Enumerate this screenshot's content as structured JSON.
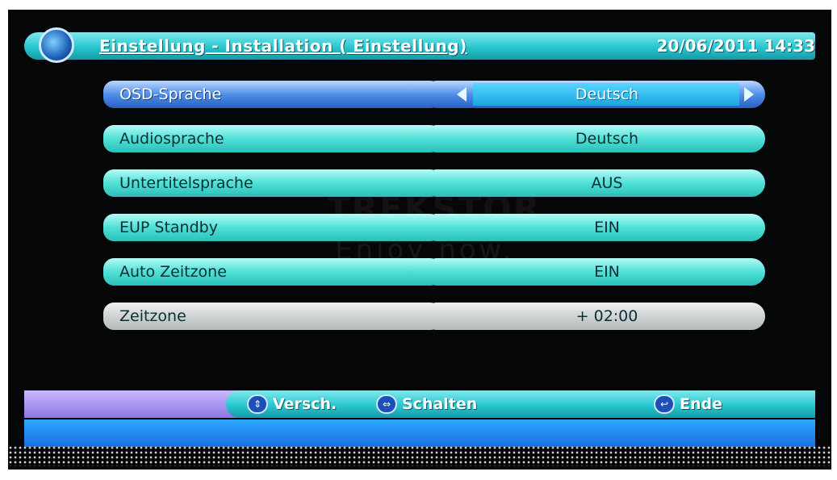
{
  "header": {
    "title": "Einstellung -  Installation ( Einstellung)",
    "datetime": "20/06/2011  14:33"
  },
  "watermark": {
    "brand": "TREKSTOR",
    "slogan": "Enjoy now."
  },
  "settings": [
    {
      "label": "OSD-Sprache",
      "value": "Deutsch",
      "selected": true
    },
    {
      "label": "Audiosprache",
      "value": "Deutsch"
    },
    {
      "label": "Untertitelsprache",
      "value": "AUS"
    },
    {
      "label": "EUP Standby",
      "value": "EIN"
    },
    {
      "label": "Auto Zeitzone",
      "value": "EIN"
    },
    {
      "label": "Zeitzone",
      "value": "+ 02:00",
      "disabled": true
    }
  ],
  "footer": {
    "move_label": "Versch.",
    "switch_label": "Schalten",
    "exit_label": "Ende"
  },
  "colors": {
    "row_active": "#4fe0d6",
    "row_selected": "#4f8fe8",
    "row_disabled": "#cfd3d3",
    "header_bar": "#29c6cf",
    "background": "#050608"
  }
}
